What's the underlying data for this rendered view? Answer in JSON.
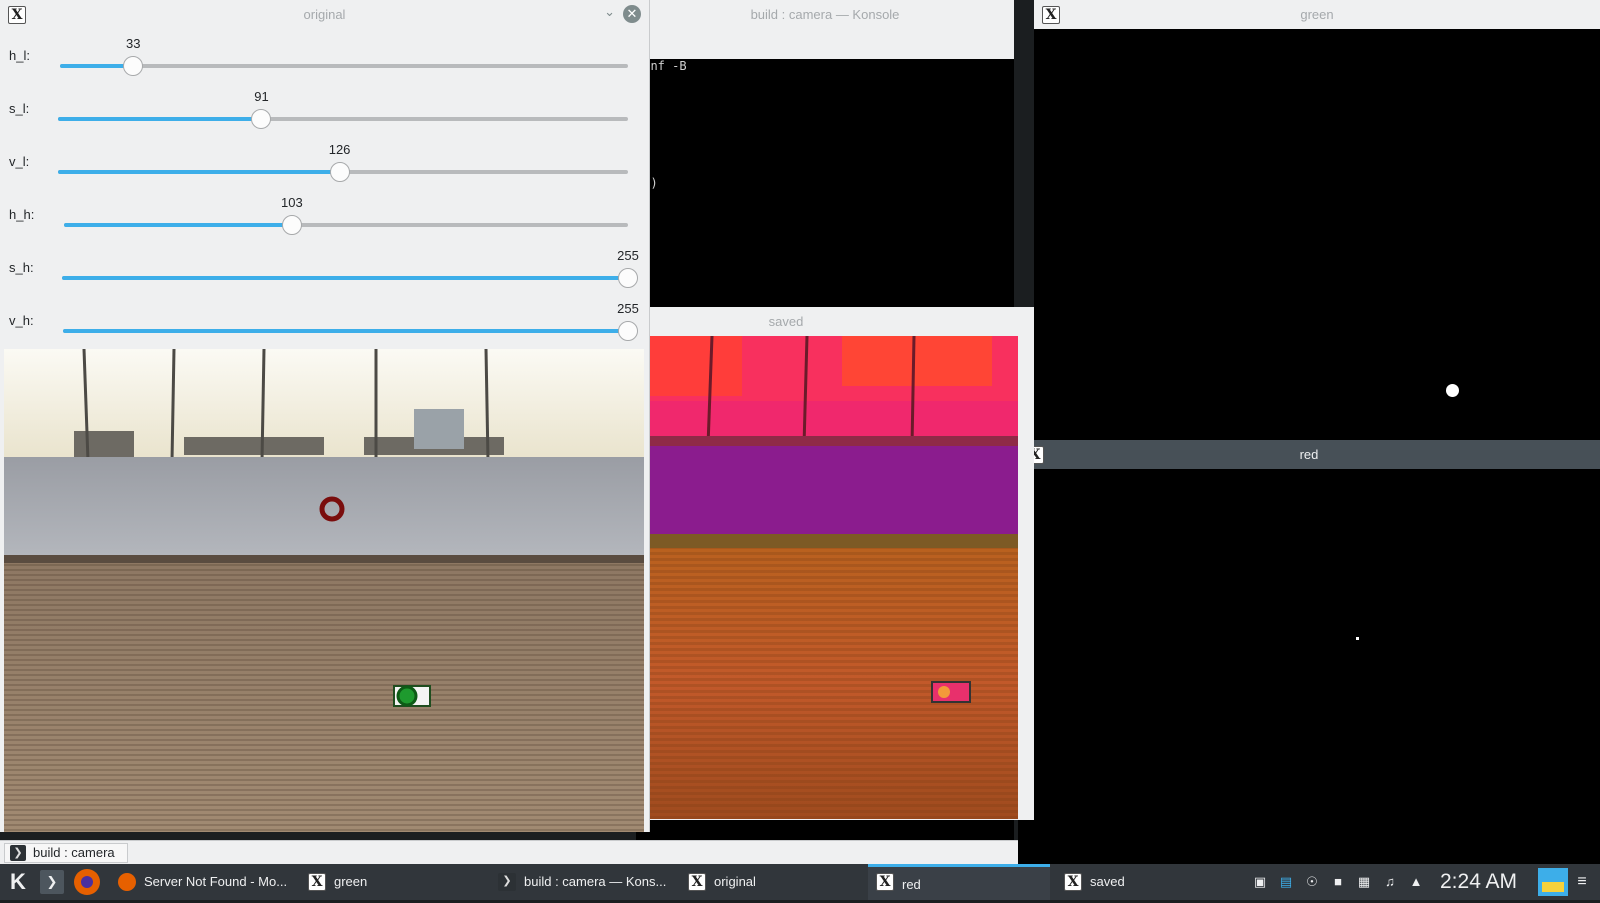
{
  "konsole": {
    "title": "build : camera — Konsole",
    "lines": [
      "conf -B",
      "ed)"
    ]
  },
  "windows": {
    "original": {
      "title": "original"
    },
    "saved": {
      "title": "saved"
    },
    "green": {
      "title": "green"
    },
    "red": {
      "title": "red"
    }
  },
  "trackbars": [
    {
      "label": "h_l:",
      "value": "33"
    },
    {
      "label": "s_l:",
      "value": "91"
    },
    {
      "label": "v_l:",
      "value": "126"
    },
    {
      "label": "h_h:",
      "value": "103"
    },
    {
      "label": "s_h:",
      "value": "255"
    },
    {
      "label": "v_h:",
      "value": "255"
    }
  ],
  "trackbar_fractions": [
    0.129,
    0.357,
    0.494,
    0.404,
    1.0,
    1.0
  ],
  "konsole_tab": {
    "label": "build : camera"
  },
  "taskbar": {
    "tasks": [
      {
        "label": "Server Not Found - Mo...",
        "icon": "firefox-icon"
      },
      {
        "label": "green",
        "icon": "x-icon"
      },
      {
        "label": "build : camera — Kons...",
        "icon": "terminal-icon"
      },
      {
        "label": "original",
        "icon": "x-icon"
      },
      {
        "label": "red",
        "icon": "x-icon"
      },
      {
        "label": "saved",
        "icon": "x-icon"
      }
    ],
    "clock": "2:24 AM"
  },
  "colors": {
    "accent": "#3daee9",
    "titlebar": "#eff0f1",
    "active_titlebar": "#475057",
    "taskbar": "#31363b"
  }
}
